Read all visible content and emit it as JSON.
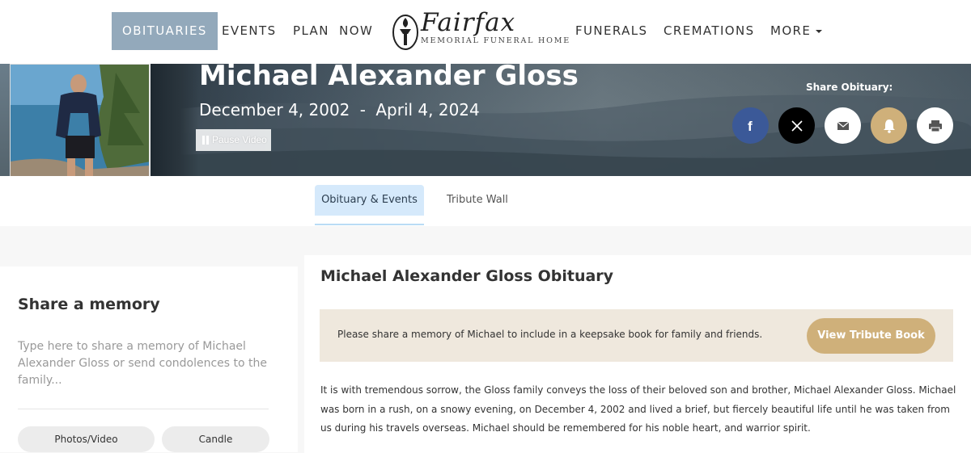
{
  "nav": {
    "items": [
      {
        "label": "OBITUARIES",
        "active": true
      },
      {
        "label": "EVENTS"
      },
      {
        "label": "PLAN  NOW"
      },
      {
        "label": "FUNERALS"
      },
      {
        "label": "CREMATIONS"
      },
      {
        "label": "MORE"
      }
    ],
    "logo": {
      "script": "Fairfax",
      "subtitle": "MEMORIAL FUNERAL HOME"
    }
  },
  "hero": {
    "name": "Michael Alexander Gloss",
    "birth": "December 4, 2002",
    "separator": "-",
    "death": "April 4, 2024",
    "pause_label": "Pause Video",
    "share_label": "Share Obituary:",
    "share_buttons": [
      {
        "icon": "facebook-icon",
        "color": "#3b5998"
      },
      {
        "icon": "x-icon",
        "color": "#000000"
      },
      {
        "icon": "email-icon",
        "color": "#ffffff"
      },
      {
        "icon": "bell-icon",
        "color": "#cfb07a"
      },
      {
        "icon": "print-icon",
        "color": "#ffffff"
      }
    ]
  },
  "tabs": [
    {
      "label": "Obituary & Events",
      "active": true
    },
    {
      "label": "Tribute Wall"
    }
  ],
  "memory": {
    "title": "Share a memory",
    "placeholder": "Type here to share a memory of Michael Alexander Gloss or send condolences to the family...",
    "buttons": [
      "Photos/Video",
      "Candle"
    ]
  },
  "obituary": {
    "title": "Michael Alexander Gloss Obituary",
    "tribute_prompt": "Please share a memory of Michael to include in a keepsake book for family and friends.",
    "tribute_button": "View Tribute Book",
    "body": "It is with tremendous sorrow, the Gloss family conveys the loss of their beloved son and brother, Michael Alexander Gloss. Michael was born in a rush, on a snowy evening, on December 4, 2002 and lived a brief, but fiercely beautiful life until he was taken from us during his travels overseas. Michael should be remembered for his noble heart, and warrior spirit."
  },
  "colors": {
    "nav_active": "#93a9bb",
    "accent_gold": "#cfb07a",
    "tab_active": "#d5e9fb",
    "tribute_bg": "#efe8dd"
  }
}
